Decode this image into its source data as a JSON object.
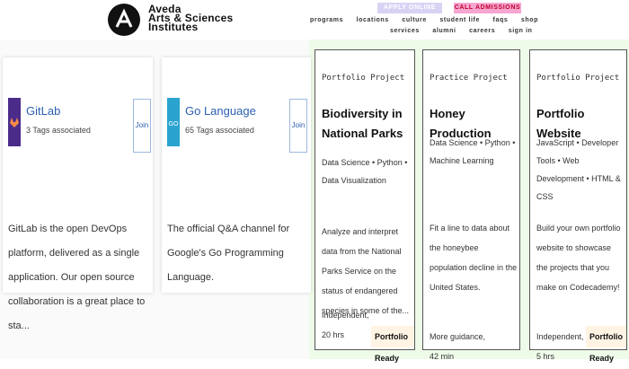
{
  "header": {
    "brand_lines": [
      "Aveda",
      "Arts & Sciences",
      "Institutes"
    ],
    "apply_label": "APPLY ONLINE",
    "call_label": "CALL ADMISSIONS",
    "nav_primary": [
      "programs",
      "locations",
      "culture",
      "student life",
      "faqs",
      "shop"
    ],
    "nav_secondary": [
      "services",
      "alumni",
      "careers",
      "sign in"
    ]
  },
  "communities": [
    {
      "name": "GitLab",
      "meta": "3 Tags associated",
      "join": "Join",
      "description": "GitLab is the open DevOps platform, delivered as a single application. Our open source collaboration is a great place to sta..."
    },
    {
      "name": "Go Language",
      "meta": "65 Tags associated",
      "join": "Join",
      "description": "The official Q&A channel for Google's Go Programming Language."
    }
  ],
  "projects": [
    {
      "kicker": "Portfolio Project",
      "title": "Biodiversity in National Parks",
      "tags": "Data Science • Python • Data Visualization",
      "description": "Analyze and interpret data from the National Parks Service on the status of endangered species in some of the...",
      "footer": "Independent, 20 hrs",
      "badge": "Portfolio Ready"
    },
    {
      "kicker": "Practice Project",
      "title": "Honey Production",
      "tags": "Data Science • Python • Machine Learning",
      "description": "Fit a line to data about the honeybee population decline in the United States.",
      "footer": "More guidance, 42 min",
      "badge": ""
    },
    {
      "kicker": "Portfolio Project",
      "title": "Portfolio Website",
      "tags": "JavaScript • Developer Tools • Web Development • HTML & CSS",
      "description": "Build your own portfolio website to showcase the projects that you make on Codecademy!",
      "footer": "Independent, 5 hrs",
      "badge": "Portfolio Ready"
    }
  ],
  "colors": {
    "accent": "#2b5fb1",
    "apply_bg": "#d9d2f5",
    "call_bg": "#f6a7d1",
    "project_band": "#eefbe9"
  }
}
